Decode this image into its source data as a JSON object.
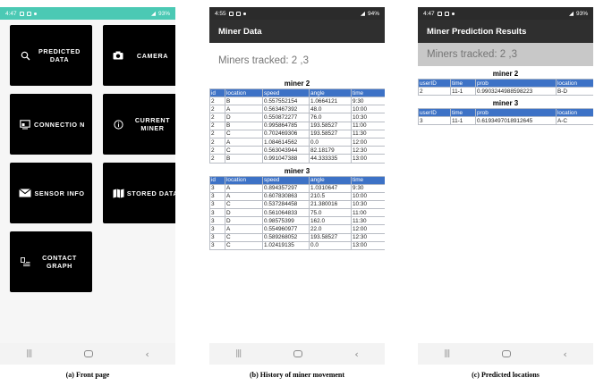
{
  "phone_a": {
    "status_time": "4:47",
    "status_right": "93%",
    "tiles": [
      {
        "label": "PREDICTED DATA",
        "icon": "search-icon"
      },
      {
        "label": "CAMERA",
        "icon": "camera-icon"
      },
      {
        "label": "CONNECTIO N",
        "icon": "connection-icon"
      },
      {
        "label": "CURRENT MINER",
        "icon": "info-icon"
      },
      {
        "label": "SENSOR INFO",
        "icon": "mail-icon"
      },
      {
        "label": "STORED DATA",
        "icon": "map-icon"
      },
      {
        "label": "CONTACT GRAPH",
        "icon": "list-icon"
      }
    ],
    "caption": "(a) Front page"
  },
  "phone_b": {
    "status_time": "4:55",
    "status_right": "94%",
    "title": "Miner Data",
    "tracked": "Miners tracked: 2 ,3",
    "tables": [
      {
        "title": "miner 2",
        "headers": [
          "id",
          "location",
          "speed",
          "angle",
          "time"
        ],
        "rows": [
          [
            "2",
            "B",
            "0.557552154",
            "1.0664121",
            "9:30"
          ],
          [
            "2",
            "A",
            "0.563467392",
            "48.0",
            "10:00"
          ],
          [
            "2",
            "D",
            "0.550872277",
            "76.0",
            "10:30"
          ],
          [
            "2",
            "B",
            "0.995864785",
            "193.58527",
            "11:00"
          ],
          [
            "2",
            "C",
            "0.702469306",
            "193.58527",
            "11:30"
          ],
          [
            "2",
            "A",
            "1.084614562",
            "0.0",
            "12:00"
          ],
          [
            "2",
            "C",
            "0.563043944",
            "82.18179",
            "12:30"
          ],
          [
            "2",
            "B",
            "0.991047388",
            "44.333335",
            "13:00"
          ]
        ]
      },
      {
        "title": "miner 3",
        "headers": [
          "id",
          "location",
          "speed",
          "angle",
          "time"
        ],
        "rows": [
          [
            "3",
            "A",
            "0.894357297",
            "1.0310647",
            "9:30"
          ],
          [
            "3",
            "A",
            "0.607830863",
            "210.5",
            "10:00"
          ],
          [
            "3",
            "C",
            "0.537284458",
            "21.380016",
            "10:30"
          ],
          [
            "3",
            "D",
            "0.561064833",
            "75.0",
            "11:00"
          ],
          [
            "3",
            "D",
            "0.98575399",
            "162.0",
            "11:30"
          ],
          [
            "3",
            "A",
            "0.554960977",
            "22.0",
            "12:00"
          ],
          [
            "3",
            "C",
            "0.589268052",
            "193.58527",
            "12:30"
          ],
          [
            "3",
            "C",
            "1.02419135",
            "0.0",
            "13:00"
          ]
        ]
      }
    ],
    "caption": "(b) History of miner movement"
  },
  "phone_c": {
    "status_time": "4:47",
    "status_right": "93%",
    "title": "Miner Prediction Results",
    "tracked": "Miners tracked: 2 ,3",
    "tables": [
      {
        "title": "miner 2",
        "headers": [
          "userID",
          "time",
          "prob",
          "location"
        ],
        "rows": [
          [
            "2",
            "11-1",
            "0.9903244988598223",
            "B-D"
          ]
        ]
      },
      {
        "title": "miner 3",
        "headers": [
          "userID",
          "time",
          "prob",
          "location"
        ],
        "rows": [
          [
            "3",
            "11-1",
            "0.6193497018912645",
            "A-C"
          ]
        ]
      }
    ],
    "caption": "(c) Predicted locations"
  },
  "colors": {
    "status_teal": "#4bc9b4",
    "appbar_dark": "#2f2f2f",
    "table_header_blue": "#3d72c6",
    "tile_black": "#000000"
  }
}
